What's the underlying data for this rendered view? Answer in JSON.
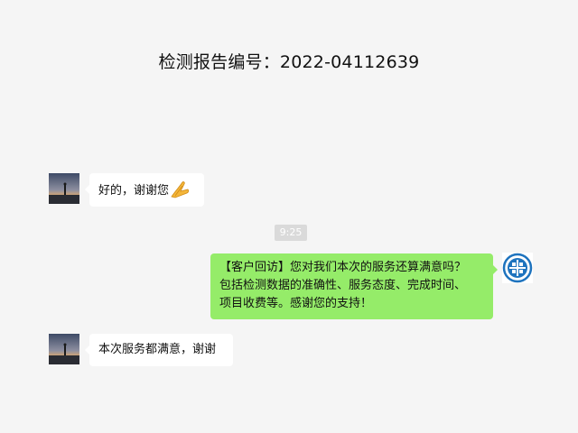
{
  "header": {
    "title": "检测报告编号：2022-04112639"
  },
  "messages": [
    {
      "side": "left",
      "text": "好的，谢谢您",
      "emoji": "folded-hands-icon"
    },
    {
      "type": "time",
      "text": "9:25"
    },
    {
      "side": "right",
      "lines": [
        "【客户回访】您对我们本次的服务还算满意吗？",
        "包括检测数据的准确性、服务态度、完成时间、",
        "项目收费等。感谢您的支持！"
      ]
    },
    {
      "side": "left",
      "text": "本次服务都满意，谢谢"
    }
  ],
  "colors": {
    "background": "#f5f5f5",
    "sent_bubble": "#95ec69",
    "received_bubble": "#ffffff",
    "logo": "#1e73be"
  }
}
